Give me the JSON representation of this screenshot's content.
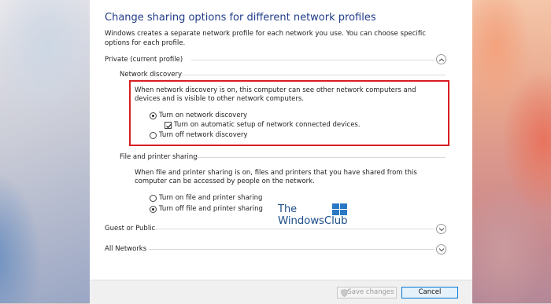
{
  "dialog": {
    "title": "Change sharing options for different network profiles",
    "description": "Windows creates a separate network profile for each network you use. You can choose specific options for each profile."
  },
  "private": {
    "label": "Private (current profile)",
    "network_discovery": {
      "heading": "Network discovery",
      "info": "When network discovery is on, this computer can see other network computers and devices and is visible to other network computers.",
      "opt_on": "Turn on network discovery",
      "opt_auto": "Turn on automatic setup of network connected devices.",
      "opt_off": "Turn off network discovery",
      "selected": "on",
      "auto_checked": true
    },
    "file_sharing": {
      "heading": "File and printer sharing",
      "info": "When file and printer sharing is on, files and printers that you have shared from this computer can be accessed by people on the network.",
      "opt_on": "Turn on file and printer sharing",
      "opt_off": "Turn off file and printer sharing",
      "selected": "off"
    }
  },
  "guest": {
    "label": "Guest or Public"
  },
  "all_networks": {
    "label": "All Networks"
  },
  "watermark": {
    "line1": "The",
    "line2": "WindowsClub"
  },
  "footer": {
    "save_label": "Save changes",
    "cancel_label": "Cancel"
  },
  "colors": {
    "title": "#1f3c88",
    "highlight": "#d81e22",
    "button_focus": "#0078d7"
  },
  "icons": {
    "expanded": "chevron-up-icon",
    "collapsed": "chevron-down-icon",
    "uac": "shield-icon"
  }
}
